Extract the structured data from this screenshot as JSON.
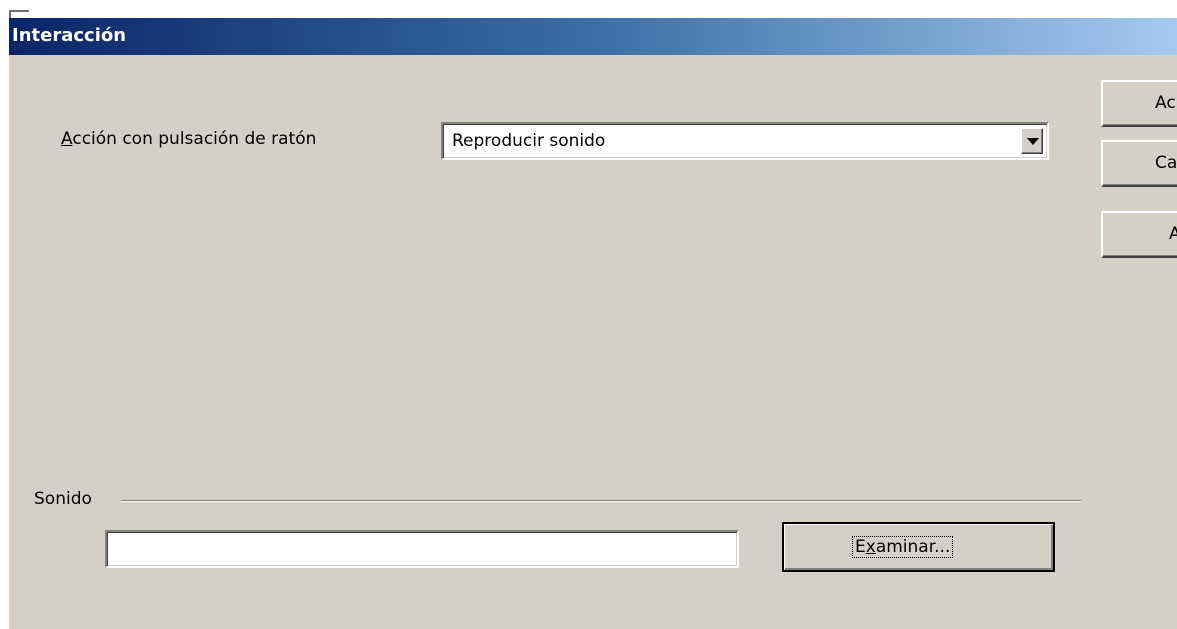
{
  "dialog": {
    "title": "Interacción"
  },
  "action": {
    "label_first": "A",
    "label_rest": "cción con pulsación de ratón",
    "selected": "Reproducir sonido"
  },
  "side_buttons": {
    "accept": "Ac",
    "cancel": "Ca",
    "help": "A"
  },
  "sound_group": {
    "label": "Sonido",
    "path_value": "",
    "browse_pre": "E",
    "browse_u": "x",
    "browse_post": "aminar..."
  }
}
